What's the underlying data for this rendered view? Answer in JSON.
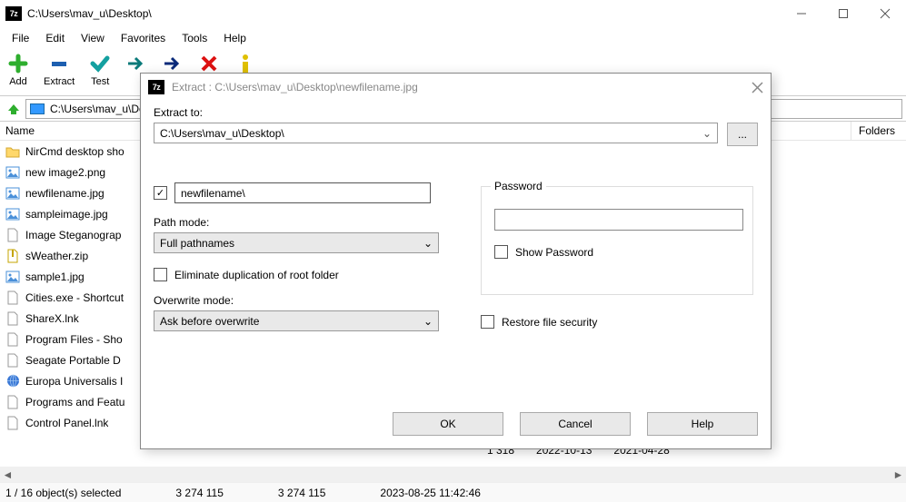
{
  "titlebar": {
    "path": "C:\\Users\\mav_u\\Desktop\\"
  },
  "menu": {
    "file": "File",
    "edit": "Edit",
    "view": "View",
    "favorites": "Favorites",
    "tools": "Tools",
    "help": "Help"
  },
  "toolbar": {
    "add": "Add",
    "extract": "Extract",
    "test": "Test"
  },
  "pathbar": {
    "value": "C:\\Users\\mav_u\\Desktop\\"
  },
  "columns": {
    "name": "Name",
    "folders": "Folders"
  },
  "files": [
    {
      "icon": "folder",
      "name": "NirCmd desktop sho"
    },
    {
      "icon": "image",
      "name": "new image2.png"
    },
    {
      "icon": "image",
      "name": "newfilename.jpg"
    },
    {
      "icon": "image",
      "name": "sampleimage.jpg"
    },
    {
      "icon": "file",
      "name": "Image Steganograp"
    },
    {
      "icon": "zip",
      "name": "sWeather.zip"
    },
    {
      "icon": "image",
      "name": "sample1.jpg"
    },
    {
      "icon": "file",
      "name": "Cities.exe - Shortcut"
    },
    {
      "icon": "file",
      "name": "ShareX.lnk"
    },
    {
      "icon": "file",
      "name": "Program Files - Sho"
    },
    {
      "icon": "file",
      "name": "Seagate Portable D"
    },
    {
      "icon": "globe",
      "name": "Europa Universalis I"
    },
    {
      "icon": "file",
      "name": "Programs and Featu"
    },
    {
      "icon": "file",
      "name": "Control Panel.lnk"
    }
  ],
  "bottom_row": {
    "size": "1 318",
    "date1": "2022-10-13",
    "date2": "2021-04-28"
  },
  "status": {
    "selection": "1 / 16 object(s) selected",
    "size1": "3 274 115",
    "size2": "3 274 115",
    "timestamp": "2023-08-25 11:42:46"
  },
  "dialog": {
    "title": "Extract : C:\\Users\\mav_u\\Desktop\\newfilename.jpg",
    "extract_to_label": "Extract to:",
    "extract_to_value": "C:\\Users\\mav_u\\Desktop\\",
    "browse_dots": "...",
    "subfolder_value": "newfilename\\",
    "path_mode_label": "Path mode:",
    "path_mode_value": "Full pathnames",
    "eliminate_label": "Eliminate duplication of root folder",
    "overwrite_label": "Overwrite mode:",
    "overwrite_value": "Ask before overwrite",
    "password_legend": "Password",
    "show_password": "Show Password",
    "restore_security": "Restore file security",
    "ok": "OK",
    "cancel": "Cancel",
    "help": "Help"
  }
}
